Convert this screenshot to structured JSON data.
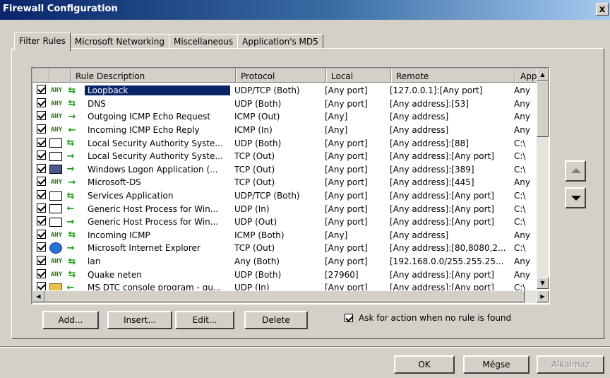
{
  "window": {
    "title": "Firewall Configuration",
    "close_label": "x"
  },
  "tabs": [
    {
      "label": "Filter Rules",
      "active": true
    },
    {
      "label": "Microsoft Networking",
      "active": false
    },
    {
      "label": "Miscellaneous",
      "active": false
    },
    {
      "label": "Application's MD5",
      "active": false
    }
  ],
  "table": {
    "headers": [
      "Rule Description",
      "Protocol",
      "Local",
      "Remote",
      "App"
    ],
    "rows": [
      {
        "checked": true,
        "icon": "any",
        "dir": "both",
        "desc": "Loopback",
        "proto": "UDP/TCP (Both)",
        "local": "[Any port]",
        "remote": "[127.0.0.1]:[Any port]",
        "app": "Any",
        "selected": true
      },
      {
        "checked": true,
        "icon": "any",
        "dir": "both",
        "desc": "DNS",
        "proto": "UDP (Both)",
        "local": "[Any port]",
        "remote": "[Any address]:[53]",
        "app": "Any"
      },
      {
        "checked": true,
        "icon": "any",
        "dir": "out",
        "desc": "Outgoing ICMP Echo Request",
        "proto": "ICMP (Out)",
        "local": "[Any]",
        "remote": "[Any address]",
        "app": "Any"
      },
      {
        "checked": true,
        "icon": "any",
        "dir": "in",
        "desc": "Incoming ICMP Echo Reply",
        "proto": "ICMP (In)",
        "local": "[Any]",
        "remote": "[Any address]",
        "app": "Any"
      },
      {
        "checked": true,
        "icon": "app",
        "dir": "both",
        "desc": "Local Security Authority Syste...",
        "proto": "UDP (Both)",
        "local": "[Any port]",
        "remote": "[Any address]:[88]",
        "app": "C:\\"
      },
      {
        "checked": true,
        "icon": "app",
        "dir": "out",
        "desc": "Local Security Authority Syste...",
        "proto": "TCP (Out)",
        "local": "[Any port]",
        "remote": "[Any address]:[Any port]",
        "app": "C:\\"
      },
      {
        "checked": true,
        "icon": "lock",
        "dir": "out",
        "desc": "Windows Logon Application (...",
        "proto": "TCP (Out)",
        "local": "[Any port]",
        "remote": "[Any address]:[389]",
        "app": "C:\\"
      },
      {
        "checked": true,
        "icon": "any",
        "dir": "out",
        "desc": "Microsoft-DS",
        "proto": "TCP (Out)",
        "local": "[Any port]",
        "remote": "[Any address]:[445]",
        "app": "Any"
      },
      {
        "checked": true,
        "icon": "app",
        "dir": "both",
        "desc": "Services Application",
        "proto": "UDP/TCP (Both)",
        "local": "[Any port]",
        "remote": "[Any address]:[Any port]",
        "app": "C:\\"
      },
      {
        "checked": true,
        "icon": "app",
        "dir": "in",
        "desc": "Generic Host Process for Win...",
        "proto": "UDP (In)",
        "local": "[Any port]",
        "remote": "[Any address]:[Any port]",
        "app": "C:\\"
      },
      {
        "checked": true,
        "icon": "app",
        "dir": "out",
        "desc": "Generic Host Process for Win...",
        "proto": "UDP (Out)",
        "local": "[Any port]",
        "remote": "[Any address]:[Any port]",
        "app": "C:\\"
      },
      {
        "checked": true,
        "icon": "any",
        "dir": "both",
        "desc": "Incoming ICMP",
        "proto": "ICMP (Both)",
        "local": "[Any]",
        "remote": "[Any address]",
        "app": "Any"
      },
      {
        "checked": true,
        "icon": "ie",
        "dir": "out",
        "desc": "Microsoft Internet Explorer",
        "proto": "TCP (Out)",
        "local": "[Any port]",
        "remote": "[Any address]:[80,8080,2...",
        "app": "C:\\"
      },
      {
        "checked": true,
        "icon": "any",
        "dir": "both",
        "desc": "lan",
        "proto": "Any (Both)",
        "local": "[Any port]",
        "remote": "[192.168.0.0/255.255.25...",
        "app": "Any"
      },
      {
        "checked": true,
        "icon": "any",
        "dir": "both",
        "desc": "Quake neten",
        "proto": "UDP (Both)",
        "local": "[27960]",
        "remote": "[Any address]:[Any port]",
        "app": "Any"
      },
      {
        "checked": true,
        "icon": "ms",
        "dir": "in",
        "desc": "MS DTC console program - qu...",
        "proto": "UDP (In)",
        "local": "[Any port]",
        "remote": "[Any address]:[Any port]",
        "app": "C:\\"
      }
    ]
  },
  "buttons": {
    "add": "Add...",
    "insert": "Insert...",
    "edit": "Edit...",
    "delete": "Delete"
  },
  "ask_checkbox": {
    "label": "Ask for action when no rule is found",
    "checked": true
  },
  "dialog_buttons": {
    "ok": "OK",
    "cancel": "Mégse",
    "apply": "Alkalmaz"
  },
  "glyphs": {
    "any_label": "ANY",
    "dir_both": "⇆",
    "dir_out": "→",
    "dir_in": "←"
  }
}
